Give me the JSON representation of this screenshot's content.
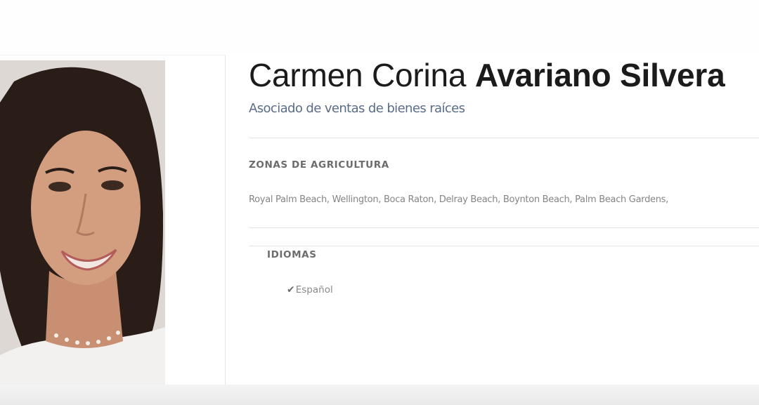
{
  "profile": {
    "first_names": "Carmen Corina",
    "last_names": "Avariano Silvera",
    "role": "Asociado de ventas de bienes raíces"
  },
  "zones": {
    "title": "ZONAS DE AGRICULTURA",
    "list": "Royal Palm Beach, Wellington, Boca Raton, Delray Beach, Boynton Beach, Palm Beach Gardens,"
  },
  "languages": {
    "title": "IDIOMAS",
    "items": [
      {
        "label": "Español",
        "icon": "check-icon"
      }
    ]
  },
  "colors": {
    "name": "#1b1b1b",
    "role": "#5a6c86",
    "section_title": "#6c6c6c",
    "body_text": "#858585",
    "divider": "#e3e3e3"
  }
}
